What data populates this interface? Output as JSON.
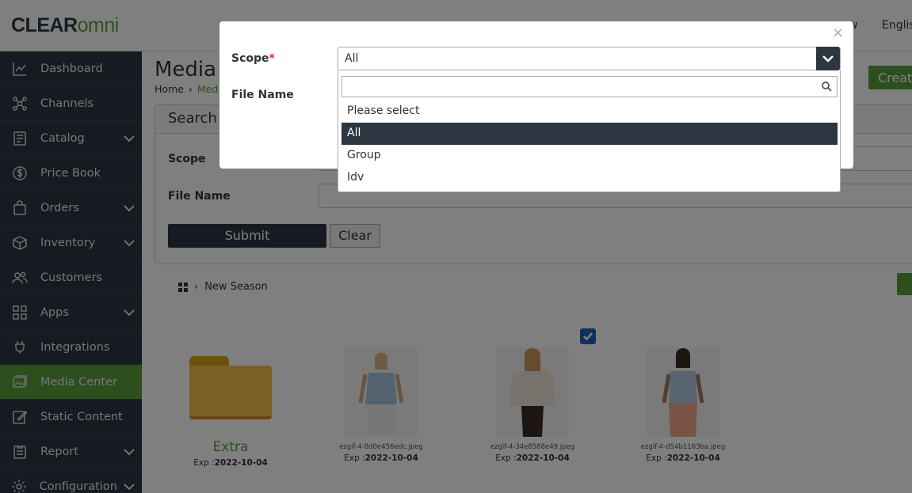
{
  "header": {
    "logo_part1": "CLEAR",
    "logo_part2": "omni",
    "link_partial": "w",
    "language": "Englis"
  },
  "sidebar": {
    "items": [
      {
        "label": "Dashboard",
        "icon": "chart-line-icon",
        "has_chevron": false
      },
      {
        "label": "Channels",
        "icon": "network-icon",
        "has_chevron": false
      },
      {
        "label": "Catalog",
        "icon": "document-icon",
        "has_chevron": true
      },
      {
        "label": "Price Book",
        "icon": "dollar-icon",
        "has_chevron": false
      },
      {
        "label": "Orders",
        "icon": "bag-icon",
        "has_chevron": true
      },
      {
        "label": "Inventory",
        "icon": "box-icon",
        "has_chevron": true
      },
      {
        "label": "Customers",
        "icon": "users-icon",
        "has_chevron": false
      },
      {
        "label": "Apps",
        "icon": "apps-icon",
        "has_chevron": true
      },
      {
        "label": "Integrations",
        "icon": "plug-icon",
        "has_chevron": false
      },
      {
        "label": "Media Center",
        "icon": "image-icon",
        "has_chevron": false,
        "active": true
      },
      {
        "label": "Static Content",
        "icon": "edit-icon",
        "has_chevron": false
      },
      {
        "label": "Report",
        "icon": "report-icon",
        "has_chevron": true
      },
      {
        "label": "Configuration",
        "icon": "gear-icon",
        "has_chevron": true
      }
    ]
  },
  "main": {
    "title": "Media",
    "breadcrumb_home": "Home",
    "breadcrumb_current": "Med",
    "create_label": "Create",
    "search": {
      "heading": "Search",
      "scope_label": "Scope",
      "file_name_label": "File Name",
      "submit_label": "Submit",
      "clear_label": "Clear"
    },
    "folder_crumb": "New Season",
    "tiles": [
      {
        "type": "folder",
        "name": "Extra",
        "exp_prefix": "Exp :",
        "exp_date": "2022-10-04"
      },
      {
        "type": "image",
        "file_name": "ezgif-4-8d0e456edc.jpeg",
        "exp_prefix": "Exp :",
        "exp_date": "2022-10-04"
      },
      {
        "type": "image",
        "file_name": "ezgif-4-34e8588e49.jpeg",
        "exp_prefix": "Exp :",
        "exp_date": "2022-10-04",
        "checked": true
      },
      {
        "type": "image",
        "file_name": "ezgif-4-d54b1163ba.jpeg",
        "exp_prefix": "Exp :",
        "exp_date": "2022-10-04"
      }
    ]
  },
  "modal": {
    "close": "×",
    "scope_label": "Scope",
    "required_mark": "*",
    "file_name_label": "File Name",
    "scope_value": "All",
    "dropdown": {
      "search_placeholder": "",
      "options": [
        "Please select",
        "All",
        "Group",
        "Idv"
      ],
      "selected": "All"
    }
  },
  "colors": {
    "sidebar_bg": "#2b3640",
    "accent_green": "#5a9e3c",
    "selected_option_bg": "#2b3640",
    "required_red": "#d9342b"
  }
}
